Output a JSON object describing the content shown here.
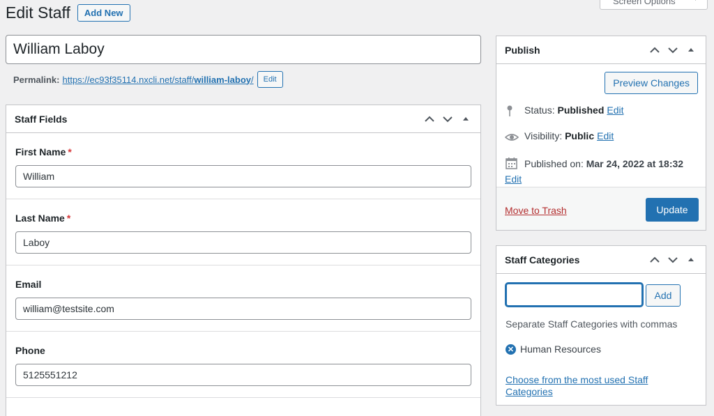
{
  "header": {
    "title": "Edit Staff",
    "add_new": "Add New",
    "screen_options": "Screen Options"
  },
  "post": {
    "title": "William Laboy"
  },
  "permalink": {
    "label": "Permalink:",
    "url_base": "https://ec93f35114.nxcli.net/staff/",
    "slug": "william-laboy",
    "url_end": "/",
    "edit": "Edit"
  },
  "staff_fields": {
    "title": "Staff Fields",
    "fields": [
      {
        "label": "First Name",
        "required": true,
        "value": "William"
      },
      {
        "label": "Last Name",
        "required": true,
        "value": "Laboy"
      },
      {
        "label": "Email",
        "required": false,
        "value": "william@testsite.com"
      },
      {
        "label": "Phone",
        "required": false,
        "value": "5125551212"
      }
    ],
    "required_mark": "*"
  },
  "publish": {
    "title": "Publish",
    "preview": "Preview Changes",
    "status_label": "Status:",
    "status_value": "Published",
    "visibility_label": "Visibility:",
    "visibility_value": "Public",
    "published_label": "Published on:",
    "published_value": "Mar 24, 2022 at 18:32",
    "edit": "Edit",
    "trash": "Move to Trash",
    "update": "Update"
  },
  "categories": {
    "title": "Staff Categories",
    "add": "Add",
    "input_value": "",
    "help": "Separate Staff Categories with commas",
    "tags": [
      "Human Resources"
    ],
    "most_used": "Choose from the most used Staff Categories"
  },
  "colors": {
    "accent": "#2271b1",
    "danger": "#b32d2e",
    "background": "#f0f0f1"
  }
}
